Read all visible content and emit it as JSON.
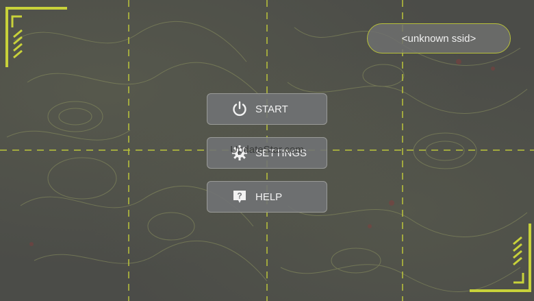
{
  "ssid": {
    "label": "<unknown ssid>"
  },
  "menu": {
    "start_label": "START",
    "settings_label": "SETTINGS",
    "help_label": "HELP"
  },
  "overlay": {
    "text": "UpdateStar.com"
  },
  "icons": {
    "start": "power-icon",
    "settings": "gear-icon",
    "help": "help-bubble-icon"
  },
  "colors": {
    "accent": "#c8d23a",
    "background": "#4b4c48",
    "button_bg": "#707274"
  }
}
